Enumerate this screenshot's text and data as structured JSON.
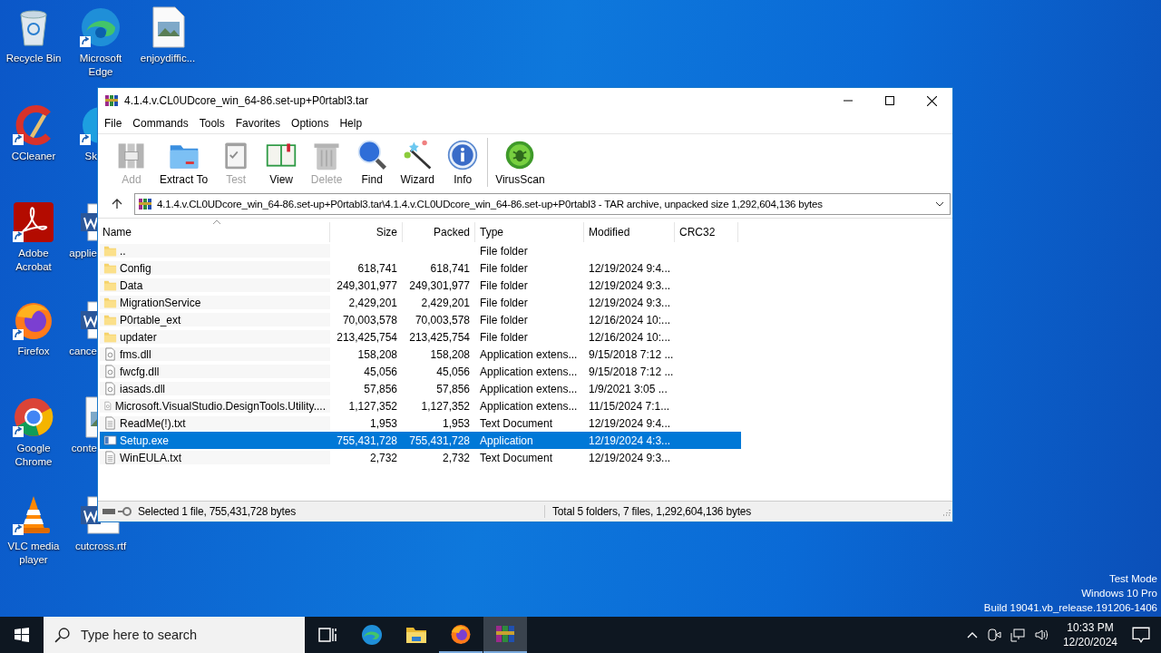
{
  "desktop_icons": [
    {
      "label": "Recycle Bin",
      "kind": "recycle",
      "shortcut": false
    },
    {
      "label": "CCleaner",
      "kind": "ccleaner",
      "shortcut": true
    },
    {
      "label": "Adobe Acrobat",
      "kind": "acrobat",
      "shortcut": true
    },
    {
      "label": "Firefox",
      "kind": "firefox",
      "shortcut": true
    },
    {
      "label": "Google Chrome",
      "kind": "chrome",
      "shortcut": true
    },
    {
      "label": "VLC media player",
      "kind": "vlc",
      "shortcut": true
    },
    {
      "label": "Microsoft Edge",
      "kind": "edge",
      "shortcut": true
    },
    {
      "label": "Sk",
      "kind": "skype",
      "shortcut": true
    },
    {
      "label": "applie",
      "kind": "word",
      "shortcut": false
    },
    {
      "label": "cance",
      "kind": "word",
      "shortcut": false
    },
    {
      "label": "conte",
      "kind": "image",
      "shortcut": false
    },
    {
      "label": "cutcross.rtf",
      "kind": "word",
      "shortcut": false
    },
    {
      "label": "enjoydiffic...",
      "kind": "image",
      "shortcut": false
    }
  ],
  "window": {
    "title": "4.1.4.v.CL0UDcore_win_64-86.set-up+P0rtabl3.tar",
    "menu": [
      "File",
      "Commands",
      "Tools",
      "Favorites",
      "Options",
      "Help"
    ],
    "toolbar": [
      {
        "label": "Add",
        "kind": "add",
        "disabled": true
      },
      {
        "label": "Extract To",
        "kind": "extract",
        "disabled": false
      },
      {
        "label": "Test",
        "kind": "test",
        "disabled": true
      },
      {
        "label": "View",
        "kind": "view",
        "disabled": false
      },
      {
        "label": "Delete",
        "kind": "delete",
        "disabled": true
      },
      {
        "label": "Find",
        "kind": "find",
        "disabled": false
      },
      {
        "label": "Wizard",
        "kind": "wizard",
        "disabled": false
      },
      {
        "label": "Info",
        "kind": "info",
        "disabled": false
      },
      {
        "label": "VirusScan",
        "kind": "virusscan",
        "disabled": false
      }
    ],
    "address": "4.1.4.v.CL0UDcore_win_64-86.set-up+P0rtabl3.tar\\4.1.4.v.CL0UDcore_win_64-86.set-up+P0rtabl3 - TAR archive, unpacked size 1,292,604,136 bytes",
    "columns": [
      "Name",
      "Size",
      "Packed",
      "Type",
      "Modified",
      "CRC32"
    ],
    "rows": [
      {
        "name": "..",
        "size": "",
        "packed": "",
        "type": "File folder",
        "modified": "",
        "kind": "folder",
        "selected": false
      },
      {
        "name": "Config",
        "size": "618,741",
        "packed": "618,741",
        "type": "File folder",
        "modified": "12/19/2024 9:4...",
        "kind": "folder",
        "selected": false
      },
      {
        "name": "Data",
        "size": "249,301,977",
        "packed": "249,301,977",
        "type": "File folder",
        "modified": "12/19/2024 9:3...",
        "kind": "folder",
        "selected": false
      },
      {
        "name": "MigrationService",
        "size": "2,429,201",
        "packed": "2,429,201",
        "type": "File folder",
        "modified": "12/19/2024 9:3...",
        "kind": "folder",
        "selected": false
      },
      {
        "name": "P0rtable_ext",
        "size": "70,003,578",
        "packed": "70,003,578",
        "type": "File folder",
        "modified": "12/16/2024 10:...",
        "kind": "folder",
        "selected": false
      },
      {
        "name": "updater",
        "size": "213,425,754",
        "packed": "213,425,754",
        "type": "File folder",
        "modified": "12/16/2024 10:...",
        "kind": "folder",
        "selected": false
      },
      {
        "name": "fms.dll",
        "size": "158,208",
        "packed": "158,208",
        "type": "Application extens...",
        "modified": "9/15/2018 7:12 ...",
        "kind": "dll",
        "selected": false
      },
      {
        "name": "fwcfg.dll",
        "size": "45,056",
        "packed": "45,056",
        "type": "Application extens...",
        "modified": "9/15/2018 7:12 ...",
        "kind": "dll",
        "selected": false
      },
      {
        "name": "iasads.dll",
        "size": "57,856",
        "packed": "57,856",
        "type": "Application extens...",
        "modified": "1/9/2021 3:05 ...",
        "kind": "dll",
        "selected": false
      },
      {
        "name": "Microsoft.VisualStudio.DesignTools.Utility....",
        "size": "1,127,352",
        "packed": "1,127,352",
        "type": "Application extens...",
        "modified": "11/15/2024 7:1...",
        "kind": "dll",
        "selected": false
      },
      {
        "name": "ReadMe(!).txt",
        "size": "1,953",
        "packed": "1,953",
        "type": "Text Document",
        "modified": "12/19/2024 9:4...",
        "kind": "txt",
        "selected": false
      },
      {
        "name": "Setup.exe",
        "size": "755,431,728",
        "packed": "755,431,728",
        "type": "Application",
        "modified": "12/19/2024 4:3...",
        "kind": "exe",
        "selected": true
      },
      {
        "name": "WinEULA.txt",
        "size": "2,732",
        "packed": "2,732",
        "type": "Text Document",
        "modified": "12/19/2024 9:3...",
        "kind": "txt",
        "selected": false
      }
    ],
    "status_left": "Selected 1 file, 755,431,728 bytes",
    "status_right": "Total 5 folders, 7 files, 1,292,604,136 bytes"
  },
  "system_notice": [
    "Test Mode",
    "Windows 10 Pro",
    "Build 19041.vb_release.191206-1406"
  ],
  "taskbar": {
    "search_placeholder": "Type here to search",
    "apps": [
      {
        "kind": "taskview",
        "running": false,
        "selected": false
      },
      {
        "kind": "edge",
        "running": false,
        "selected": false
      },
      {
        "kind": "explorer",
        "running": false,
        "selected": false
      },
      {
        "kind": "firefox",
        "running": true,
        "selected": false
      },
      {
        "kind": "winrar",
        "running": true,
        "selected": true
      }
    ],
    "time": "10:33 PM",
    "date": "12/20/2024"
  }
}
